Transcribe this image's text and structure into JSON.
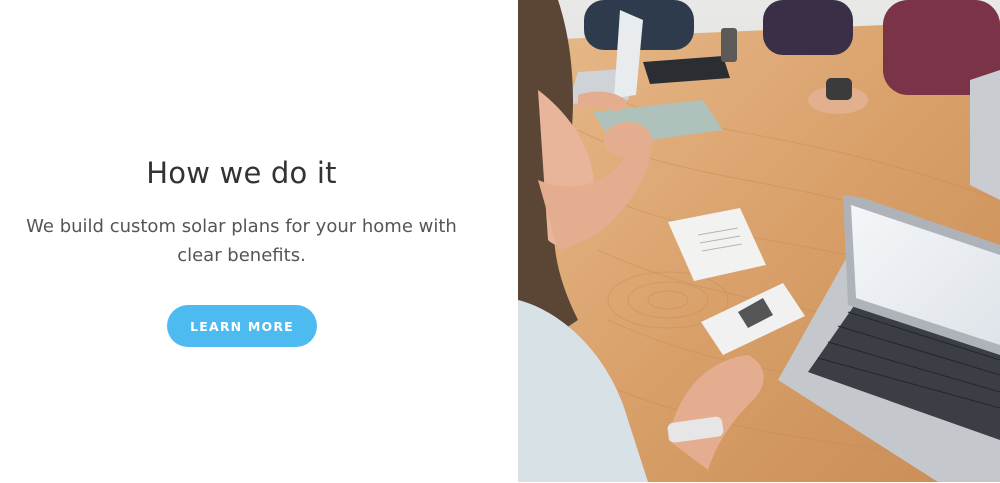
{
  "section": {
    "heading": "How we do it",
    "body_line_1": "We build custom solar plans for your home with",
    "body_line_2": "clear benefits.",
    "cta_label": "LEARN MORE"
  },
  "colors": {
    "accent": "#4dbbf0",
    "heading": "#333333",
    "body": "#555555"
  },
  "photo": {
    "subject": "team-meeting-photo"
  }
}
